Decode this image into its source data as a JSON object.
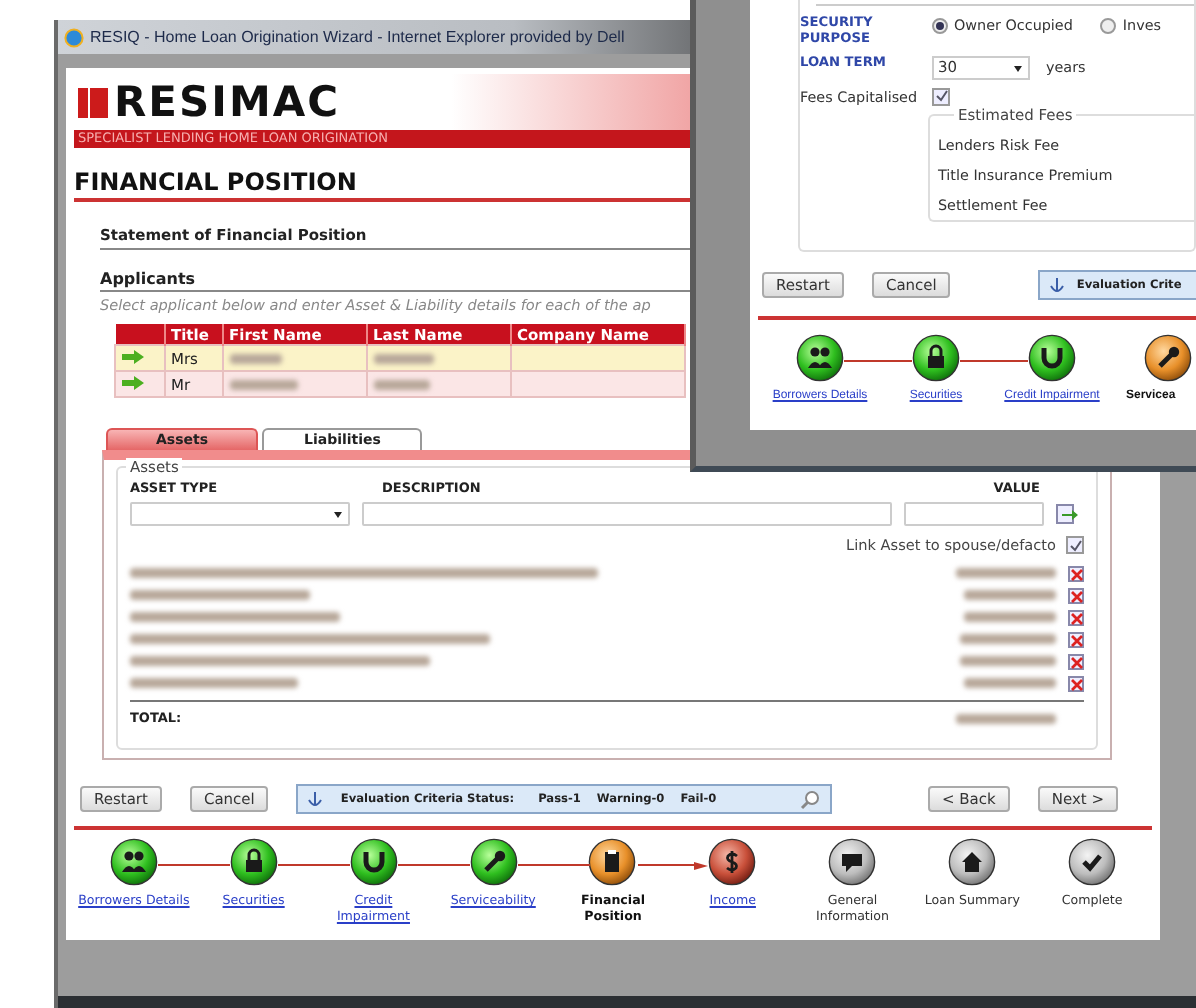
{
  "browser_window": {
    "title": "RESIQ - Home Loan Origination Wizard - Internet Explorer provided by Dell"
  },
  "banner": {
    "logo": "RESIMAC",
    "tagline": "SPECIALIST LENDING HOME LOAN ORIGINATION"
  },
  "page_title": "FINANCIAL POSITION",
  "section_title": "Statement of Financial Position",
  "applicants": {
    "heading": "Applicants",
    "instruction": "Select applicant below and enter Asset & Liability details for each of the ap",
    "columns": [
      "Title",
      "First Name",
      "Last Name",
      "Company Name"
    ],
    "rows": [
      {
        "title": "Mrs",
        "selected": true,
        "names_redacted": true
      },
      {
        "title": "Mr",
        "selected": false,
        "names_redacted": true
      }
    ]
  },
  "tabs": [
    {
      "label": "Assets",
      "selected": true
    },
    {
      "label": "Liabilities",
      "selected": false
    }
  ],
  "assets": {
    "legend": "Assets",
    "columns": [
      "ASSET TYPE",
      "DESCRIPTION",
      "VALUE"
    ],
    "link_label": "Link Asset to spouse/defacto",
    "link_checked": true,
    "total_label": "TOTAL:",
    "total_redacted": true,
    "rows": [
      {
        "redacted": true
      },
      {
        "redacted": true
      },
      {
        "redacted": true
      },
      {
        "redacted": true
      },
      {
        "redacted": true
      },
      {
        "redacted": true
      }
    ]
  },
  "buttons": {
    "left": [
      "Restart",
      "Cancel"
    ],
    "right": [
      "< Back",
      "Next >"
    ]
  },
  "evaluation": {
    "label": "Evaluation Criteria Status:",
    "pass": "Pass-1",
    "warning": "Warning-0",
    "fail": "Fail-0"
  },
  "steps": [
    {
      "label": "Borrowers Details",
      "kind": "done"
    },
    {
      "label": "Securities",
      "kind": "done"
    },
    {
      "label": "Credit Impairment",
      "kind": "done"
    },
    {
      "label": "Serviceability",
      "kind": "done"
    },
    {
      "label": "Financial Position",
      "kind": "current"
    },
    {
      "label": "Income",
      "kind": "next"
    },
    {
      "label": "General Information",
      "kind": "pending"
    },
    {
      "label": "Loan Summary",
      "kind": "pending"
    },
    {
      "label": "Complete",
      "kind": "pending"
    }
  ],
  "overlay_window": {
    "security_purpose_label": "SECURITY PURPOSE",
    "purpose_options": [
      {
        "label": "Owner Occupied",
        "selected": true
      },
      {
        "label": "Inves",
        "selected": false
      }
    ],
    "loan_term_label": "LOAN TERM",
    "loan_term_value": "30",
    "loan_term_unit": "years",
    "fees_capitalised_label": "Fees Capitalised",
    "fees_capitalised_checked": true,
    "estimated_fees": {
      "legend": "Estimated Fees",
      "items": [
        "Lenders Risk Fee",
        "Title Insurance Premium",
        "Settlement Fee"
      ]
    },
    "buttons": [
      "Restart",
      "Cancel"
    ],
    "evaluation_button": "Evaluation Crite",
    "steps": [
      {
        "label": "Borrowers Details",
        "kind": "done"
      },
      {
        "label": "Securities",
        "kind": "done"
      },
      {
        "label": "Credit Impairment",
        "kind": "done"
      },
      {
        "label": "Servicea",
        "kind": "current"
      }
    ]
  }
}
